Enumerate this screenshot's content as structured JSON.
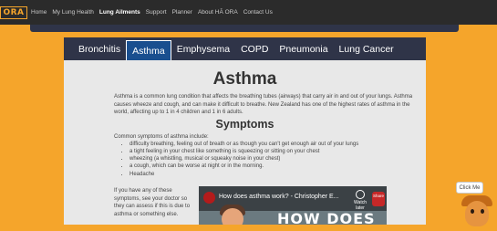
{
  "logo": {
    "text": "ORA"
  },
  "nav": {
    "items": [
      "Home",
      "My Lung Health",
      "Lung Ailments",
      "Support",
      "Planner",
      "About HĀ ORA",
      "Contact Us"
    ],
    "active_index": 2
  },
  "tabs": {
    "items": [
      "Bronchitis",
      "Asthma",
      "Emphysema",
      "COPD",
      "Pneumonia",
      "Lung Cancer"
    ],
    "active_index": 1
  },
  "main": {
    "title": "Asthma",
    "intro": "Asthma is a common lung condition that affects the breathing tubes (airways) that carry air in and out of your lungs. Asthma causes wheeze and cough, and can make it difficult to breathe. New Zealand has one of the highest rates of asthma in the world, affecting up to 1 in 4 children and 1 in 6 adults.",
    "symptoms_title": "Symptoms",
    "symptoms_intro": "Common symptoms of asthma include:",
    "symptoms": [
      "difficulty breathing, feeling out of breath or as though you can't get enough air out of your lungs",
      "a tight feeling in your chest like something is squeezing or sitting on your chest",
      "wheezing (a whistling, musical or squeaky noise in your chest)",
      "a cough, which can be worse at night or in the morning.",
      "Headache"
    ],
    "side_note": "If you have any of these symptoms, see your doctor so they can assess if this is due to asthma or something else."
  },
  "video": {
    "title": "How does asthma work? - Christopher E...",
    "watch_later": "Watch later",
    "share": "Share",
    "overlay_text": "HOW DOES"
  },
  "helper": {
    "label": "Click Me"
  },
  "colors": {
    "frame": "#f5a52b",
    "topbar": "#2b2b2b",
    "tabbar": "#2f3448",
    "active_tab": "#1a4f8f",
    "content_bg": "#e8e8e8"
  }
}
